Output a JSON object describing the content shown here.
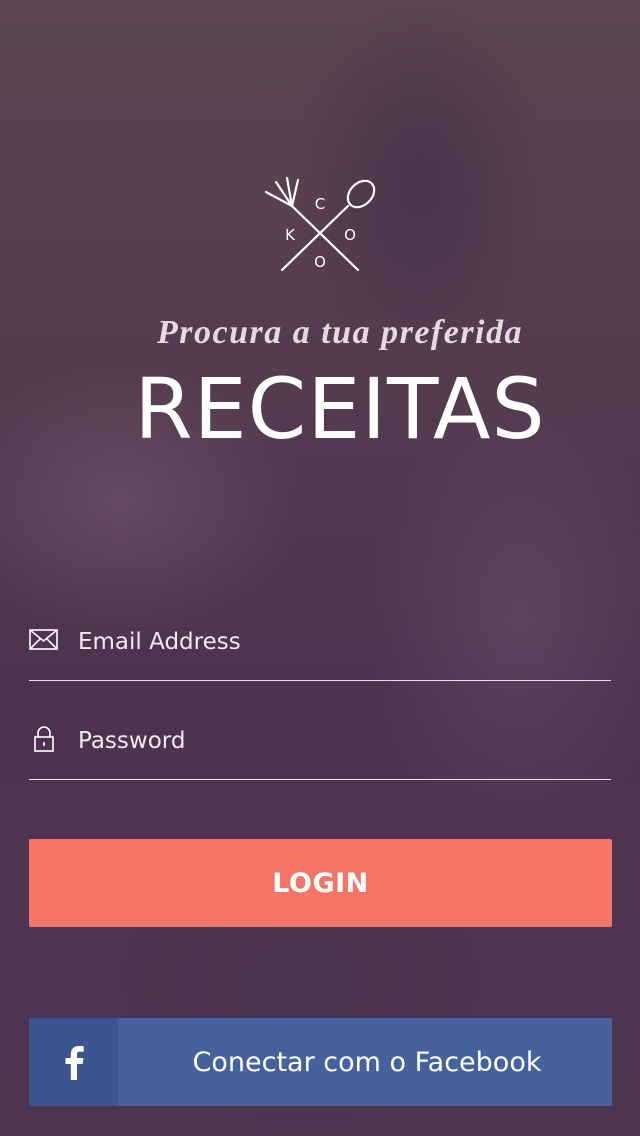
{
  "brand": {
    "logo_letters": [
      "C",
      "K",
      "O",
      "O"
    ]
  },
  "hero": {
    "tagline": "Procura a tua preferida",
    "title": "RECEITAS"
  },
  "form": {
    "email": {
      "placeholder": "Email Address",
      "value": "",
      "icon": "envelope-icon"
    },
    "password": {
      "placeholder": "Password",
      "value": "",
      "icon": "lock-icon"
    },
    "login_label": "LOGIN",
    "facebook_label": "Conectar com o Facebook"
  },
  "colors": {
    "login_button": "#f47468",
    "facebook_button": "#45629e",
    "facebook_icon_box": "#3a5590"
  }
}
